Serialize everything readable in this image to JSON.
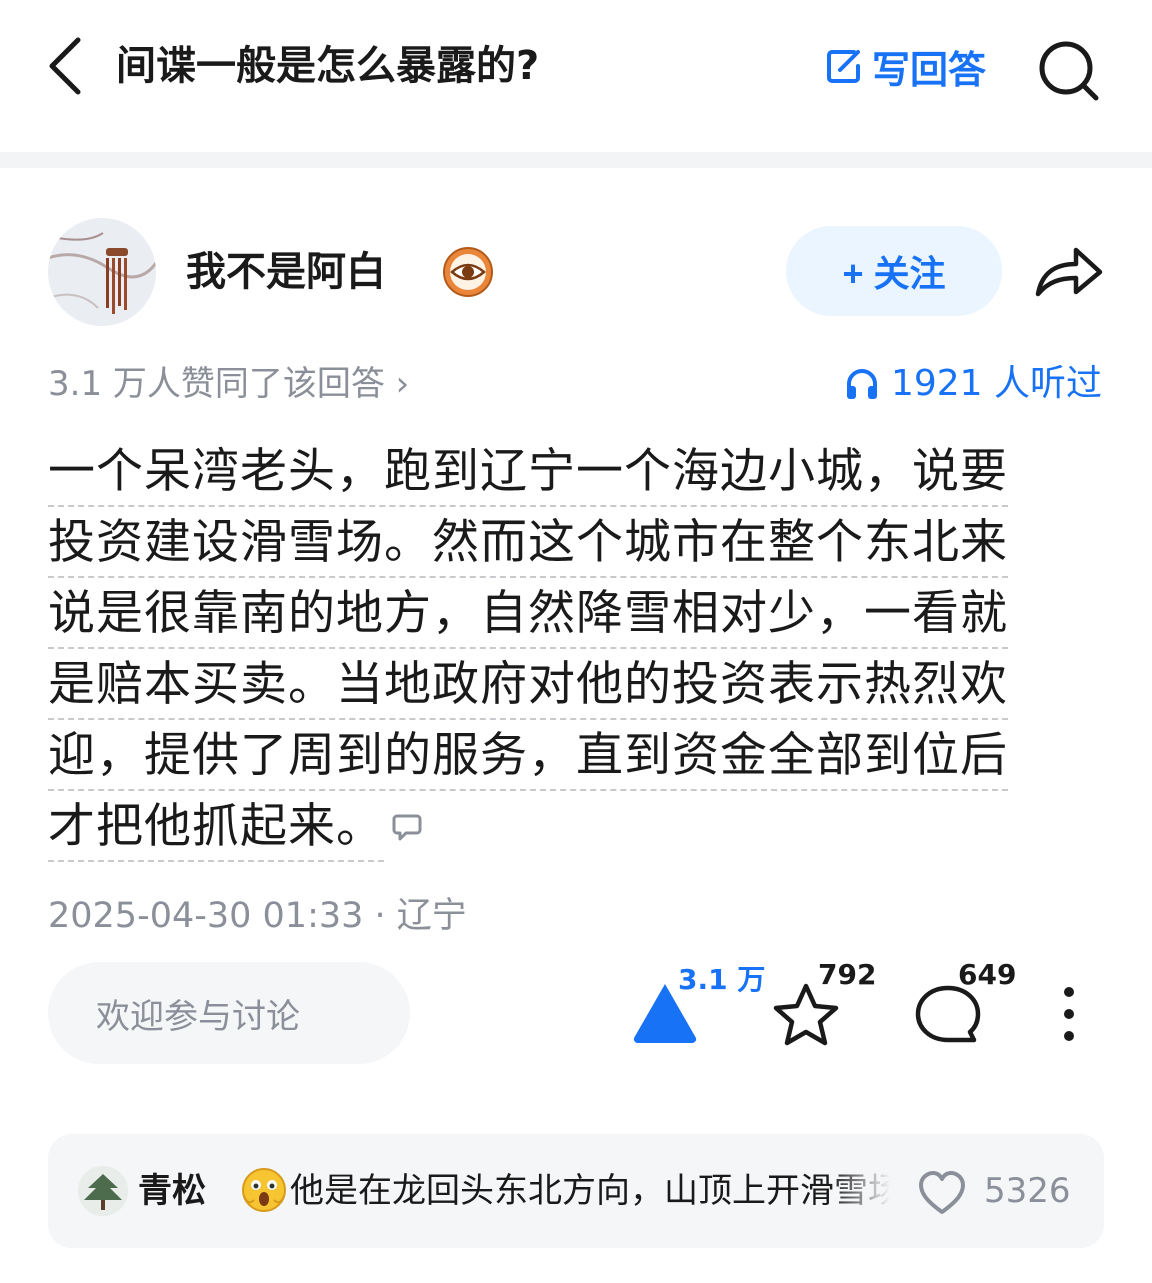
{
  "header": {
    "question_title": "间谍一般是怎么暴露的?",
    "write_answer_label": "写回答",
    "accent_color": "#1772f6"
  },
  "author": {
    "name": "我不是阿白",
    "follow_label": "+ 关注"
  },
  "meta": {
    "approve_text": "3.1 万人赞同了该回答 ›",
    "listen_text": "1921 人听过"
  },
  "answer": {
    "lines": [
      "一个呆湾老头，跑到辽宁一个海边小城，说要",
      "投资建设滑雪场。然而这个城市在整个东北来",
      "说是很靠南的地方，自然降雪相对少，一看就",
      "是赔本买卖。当地政府对他的投资表示热烈欢",
      "迎，提供了周到的服务，直到资金全部到位后",
      "才把他抓起来。"
    ],
    "time_location": "2025-04-30 01:33 · 辽宁"
  },
  "actions": {
    "discuss_placeholder": "欢迎参与讨论",
    "upvote_count": "3.1 万",
    "favorite_count": "792",
    "comment_count": "649"
  },
  "top_comment": {
    "user": "青松",
    "text": "他是在龙回头东北方向，山顶上开滑雪场",
    "like_count": "5326"
  }
}
